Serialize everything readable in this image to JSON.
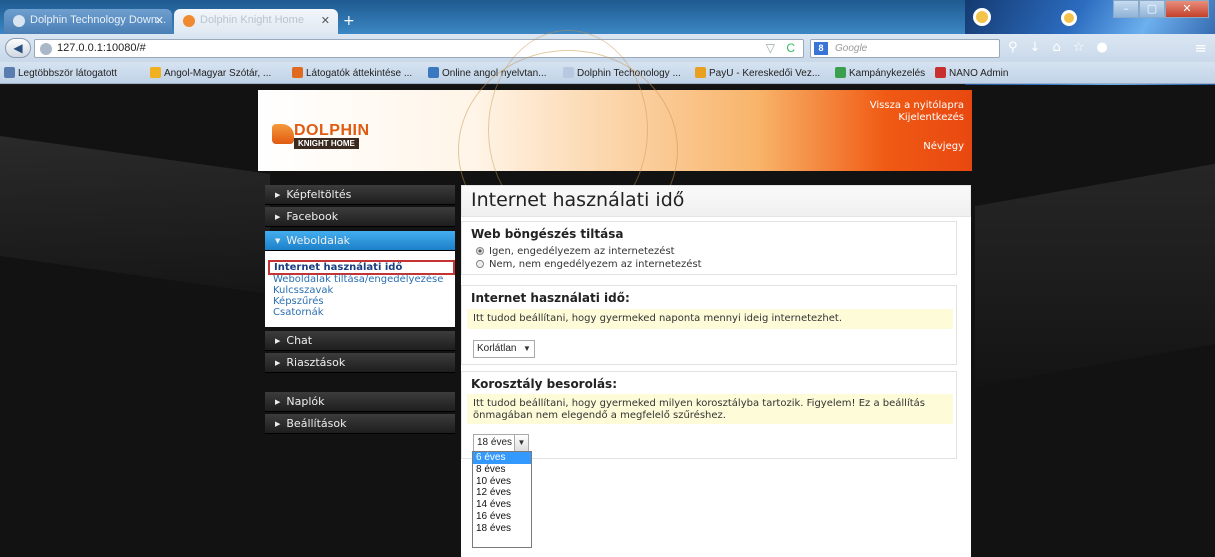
{
  "browser": {
    "tabs": [
      {
        "label": "Dolphin Technology Down...",
        "active": false
      },
      {
        "label": "Dolphin Knight Home",
        "active": true
      }
    ],
    "new_tab": "+",
    "url": "127.0.0.1:10080/#",
    "search_placeholder": "Google",
    "bookmarks": [
      {
        "label": "Legtöbbször látogatott",
        "icon_color": "#5a7db0"
      },
      {
        "label": "Angol-Magyar Szótár, ...",
        "icon_color": "#f0b020"
      },
      {
        "label": "Látogatók áttekintése ...",
        "icon_color": "#e06a20"
      },
      {
        "label": "Online angol nyelvtan...",
        "icon_color": "#3a78c0"
      },
      {
        "label": "Dolphin Techonology ...",
        "icon_color": "#b8c8e0"
      },
      {
        "label": "PayU - Kereskedői Vez...",
        "icon_color": "#e8a020"
      },
      {
        "label": "Kampánykezelés",
        "icon_color": "#3aa050"
      },
      {
        "label": "NANO Admin",
        "icon_color": "#c83030"
      }
    ]
  },
  "header": {
    "logo_name": "DOLPHIN",
    "logo_sub": "KNIGHT HOME",
    "link_home": "Vissza a nyitólapra",
    "link_logout": "Kijelentkezés",
    "link_glossary": "Névjegy"
  },
  "sidebar": {
    "items": [
      {
        "label": "Képfeltöltés"
      },
      {
        "label": "Facebook"
      },
      {
        "label": "Weboldalak"
      },
      {
        "label": "Chat"
      },
      {
        "label": "Riasztások"
      },
      {
        "label": "Naplók"
      },
      {
        "label": "Beállítások"
      }
    ],
    "sub": [
      {
        "label": "Internet használati idő"
      },
      {
        "label": "Weboldalak tiltása/engedélyezése"
      },
      {
        "label": "Kulcsszavak"
      },
      {
        "label": "Képszűrés"
      },
      {
        "label": "Csatornák"
      }
    ]
  },
  "content": {
    "title": "Internet használati idő",
    "web_block": {
      "heading": "Web böngészés tiltása",
      "opt_yes": "Igen, engedélyezem az internetezést",
      "opt_no": "Nem, nem engedélyezem az internetezést"
    },
    "time_block": {
      "heading": "Internet használati idő:",
      "note": "Itt tudod beállítani, hogy gyermeked naponta mennyi ideig internetezhet.",
      "select_value": "Korlátlan"
    },
    "age_block": {
      "heading": "Korosztály besorolás:",
      "note": "Itt tudod beállítani, hogy gyermeked milyen korosztályba tartozik. Figyelem! Ez a beállítás önmagában nem elegendő a megfelelő szűréshez.",
      "select_value": "18 éves",
      "options": [
        "6 éves",
        "8 éves",
        "10 éves",
        "12 éves",
        "14 éves",
        "16 éves",
        "18 éves"
      ]
    }
  }
}
